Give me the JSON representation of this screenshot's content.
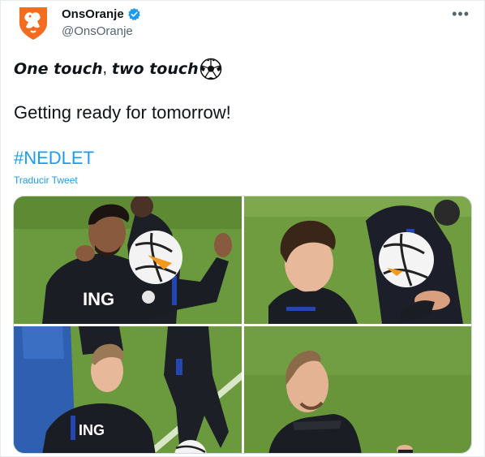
{
  "author": {
    "display_name": "OnsOranje",
    "handle": "@OnsOranje",
    "verified": true,
    "avatar_icon": "knvb-lion-logo",
    "brand_color": "#f36c21"
  },
  "tweet": {
    "line1_part1": "One touch",
    "line1_sep": ",",
    "line1_part2": "two touch",
    "line1_emoji": "soccer-ball-icon",
    "line2": "Getting ready for tomorrow!",
    "hashtag": "#NEDLET",
    "translate_label": "Traducir Tweet"
  },
  "media": {
    "photos": [
      {
        "description": "player",
        "shirt_text": "ING"
      },
      {
        "description": "player"
      },
      {
        "description": "player",
        "shirt_text": "ING"
      },
      {
        "description": "player"
      }
    ]
  },
  "menu": {
    "more_label": "•••"
  },
  "colors": {
    "link": "#1d9bf0",
    "pitch": "#6e9a3c",
    "kit": "#1a1d24"
  }
}
